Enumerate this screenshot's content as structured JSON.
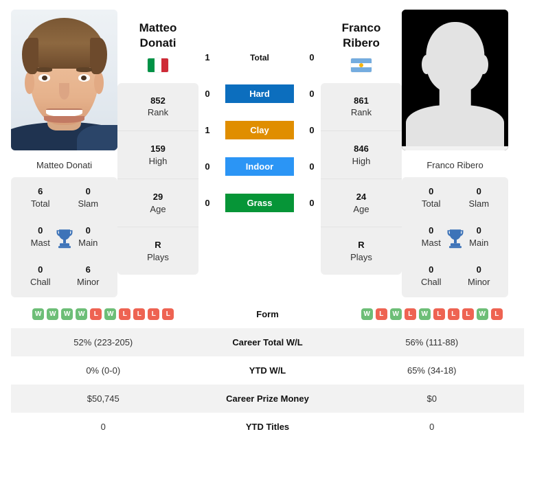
{
  "players": {
    "left": {
      "first_name": "Matteo",
      "last_name": "Donati",
      "full_name": "Matteo Donati",
      "country": "Italy",
      "flag_icon": "flag-italy",
      "photo_type": "player-photo",
      "rank": "852",
      "rank_label": "Rank",
      "high": "159",
      "high_label": "High",
      "age": "29",
      "age_label": "Age",
      "plays": "R",
      "plays_label": "Plays",
      "titles": {
        "total": "6",
        "total_label": "Total",
        "slam": "0",
        "slam_label": "Slam",
        "mast": "0",
        "mast_label": "Mast",
        "main": "0",
        "main_label": "Main",
        "chall": "0",
        "chall_label": "Chall",
        "minor": "6",
        "minor_label": "Minor"
      },
      "form": [
        "W",
        "W",
        "W",
        "W",
        "L",
        "W",
        "L",
        "L",
        "L",
        "L"
      ],
      "career_wl": "52% (223-205)",
      "ytd_wl": "0% (0-0)",
      "prize_money": "$50,745",
      "ytd_titles": "0"
    },
    "right": {
      "first_name": "Franco",
      "last_name": "Ribero",
      "full_name": "Franco Ribero",
      "country": "Argentina",
      "flag_icon": "flag-argentina",
      "photo_type": "player-silhouette-placeholder",
      "rank": "861",
      "rank_label": "Rank",
      "high": "846",
      "high_label": "High",
      "age": "24",
      "age_label": "Age",
      "plays": "R",
      "plays_label": "Plays",
      "titles": {
        "total": "0",
        "total_label": "Total",
        "slam": "0",
        "slam_label": "Slam",
        "mast": "0",
        "mast_label": "Mast",
        "main": "0",
        "main_label": "Main",
        "chall": "0",
        "chall_label": "Chall",
        "minor": "0",
        "minor_label": "Minor"
      },
      "form": [
        "W",
        "L",
        "W",
        "L",
        "W",
        "L",
        "L",
        "L",
        "W",
        "L"
      ],
      "career_wl": "56% (111-88)",
      "ytd_wl": "65% (34-18)",
      "prize_money": "$0",
      "ytd_titles": "0"
    }
  },
  "head_to_head": {
    "total": {
      "label": "Total",
      "left": "1",
      "right": "0",
      "color": ""
    },
    "surfaces": [
      {
        "label": "Hard",
        "left": "0",
        "right": "0",
        "color": "#0C6EBE"
      },
      {
        "label": "Clay",
        "left": "1",
        "right": "0",
        "color": "#E08E00"
      },
      {
        "label": "Indoor",
        "left": "0",
        "right": "0",
        "color": "#2B95F5"
      },
      {
        "label": "Grass",
        "left": "0",
        "right": "0",
        "color": "#069537"
      }
    ]
  },
  "comparison_rows": [
    {
      "label": "Form",
      "key": "form"
    },
    {
      "label": "Career Total W/L",
      "key": "career_wl"
    },
    {
      "label": "YTD W/L",
      "key": "ytd_wl"
    },
    {
      "label": "Career Prize Money",
      "key": "prize_money"
    },
    {
      "label": "YTD Titles",
      "key": "ytd_titles"
    }
  ],
  "icons": {
    "trophy": "trophy-icon"
  },
  "colors": {
    "win_badge": "#6DBE77",
    "loss_badge": "#EE6352",
    "card_bg": "#EFEFEF",
    "row_alt_bg": "#F2F2F2"
  }
}
